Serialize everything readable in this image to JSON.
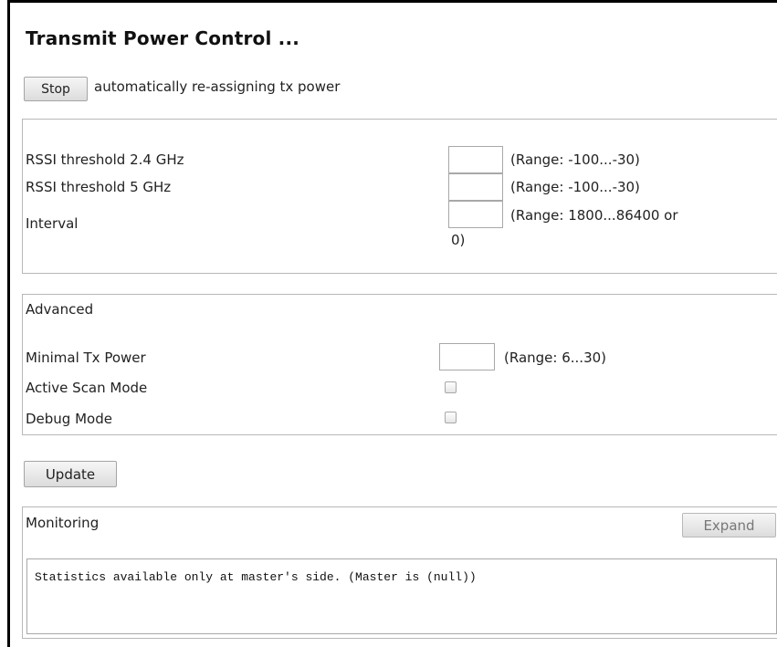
{
  "page": {
    "title": "Transmit Power Control ..."
  },
  "control": {
    "stop_label": "Stop",
    "status_text": "automatically re-assigning tx power"
  },
  "settings": {
    "rssi_24_label": "RSSI threshold 2.4 GHz",
    "rssi_24_value": "",
    "rssi_24_range": "(Range: -100...-30)",
    "rssi_5_label": "RSSI threshold 5 GHz",
    "rssi_5_value": "",
    "rssi_5_range": "(Range: -100...-30)",
    "interval_label": "Interval",
    "interval_value": "",
    "interval_range_line1": "(Range: 1800...86400 or",
    "interval_range_line2": "0)"
  },
  "advanced": {
    "heading": "Advanced",
    "min_tx_label": "Minimal Tx Power",
    "min_tx_value": "",
    "min_tx_range": "(Range: 6...30)",
    "active_scan_label": "Active Scan Mode",
    "active_scan_checked": false,
    "debug_label": "Debug Mode",
    "debug_checked": false
  },
  "actions": {
    "update_label": "Update"
  },
  "monitoring": {
    "heading": "Monitoring",
    "expand_label": "Expand",
    "expand_enabled": false,
    "output": "Statistics available only at master's side. (Master is (null))"
  }
}
